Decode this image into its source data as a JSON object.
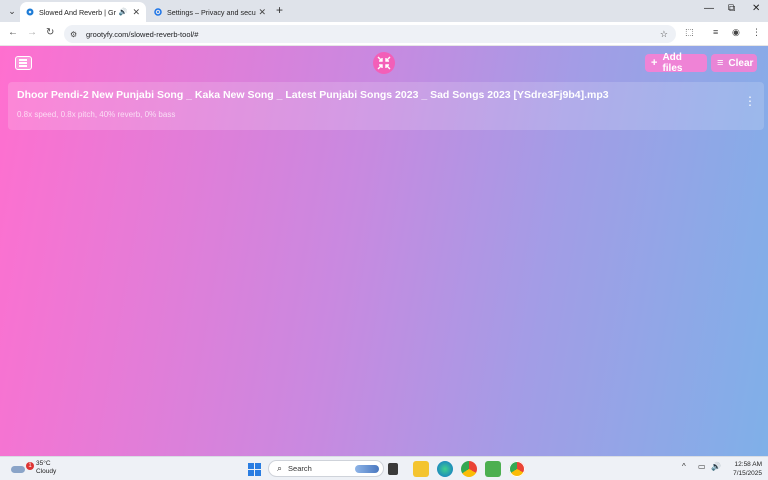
{
  "browser": {
    "tabs": [
      {
        "title": "Slowed And Reverb | Groot",
        "active": true
      },
      {
        "title": "Settings – Privacy and security",
        "active": false
      }
    ],
    "url": "grootyfy.com/slowed-reverb-tool/#",
    "new_tab_symbol": "+",
    "window_controls": {
      "minimize": "—",
      "restore": "⧉",
      "close": "✕"
    }
  },
  "app": {
    "add_files_label": "Add files",
    "clear_label": "Clear",
    "files": [
      {
        "name": "Dhoor Pendi-2 New Punjabi Song _ Kaka New Song _ Latest Punjabi Songs 2023 _ Sad Songs 2023 [YSdre3Fj9b4].mp3",
        "settings": "0.8x speed, 0.8x pitch, 40% reverb, 0% bass"
      }
    ],
    "colors": {
      "gradient_start": "#ff6fcf",
      "gradient_end": "#7fb0e8",
      "logo_bg": "#f35fb8"
    }
  },
  "taskbar": {
    "weather_temp": "35°C",
    "weather_desc": "Cloudy",
    "weather_badge": "1",
    "search_label": "Search",
    "time": "12:58 AM",
    "date": "7/15/2025"
  }
}
